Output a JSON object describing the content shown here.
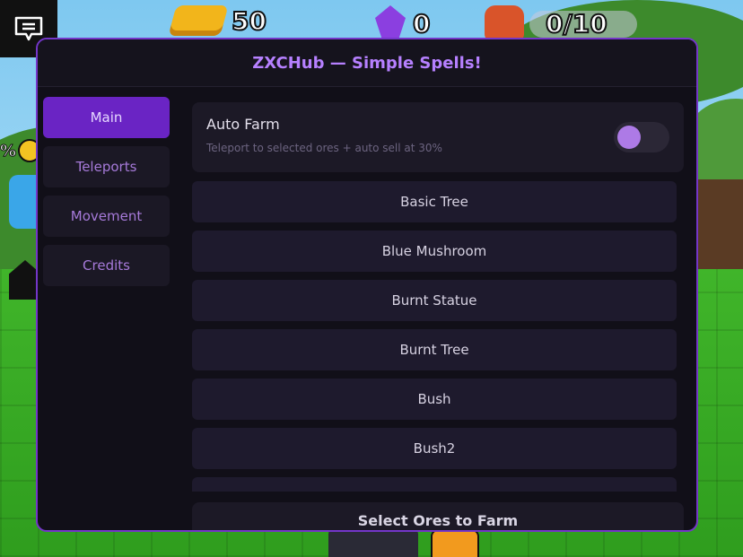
{
  "game": {
    "gold_count": "50",
    "gem_count": "0",
    "bag_capacity": "0/10",
    "side_percent": "%"
  },
  "icons": {
    "chat": "chat-icon",
    "gold": "gold-bar-icon",
    "gem": "gem-icon",
    "backpack": "backpack-icon"
  },
  "colors": {
    "accent": "#6a24c4",
    "title": "#b680ff",
    "window_border": "#7436c9",
    "toggle_knob": "#ad7ae6"
  },
  "hub": {
    "title": "ZXCHub — Simple Spells!",
    "tabs": [
      {
        "label": "Main",
        "active": true
      },
      {
        "label": "Teleports",
        "active": false
      },
      {
        "label": "Movement",
        "active": false
      },
      {
        "label": "Credits",
        "active": false
      }
    ],
    "auto_farm": {
      "title": "Auto Farm",
      "description": "Teleport to selected ores + auto sell at 30%",
      "enabled": false
    },
    "ores": [
      "Basic Tree",
      "Blue Mushroom",
      "Burnt Statue",
      "Burnt Tree",
      "Bush",
      "Bush2",
      ""
    ],
    "select_button": "Select Ores to Farm"
  }
}
